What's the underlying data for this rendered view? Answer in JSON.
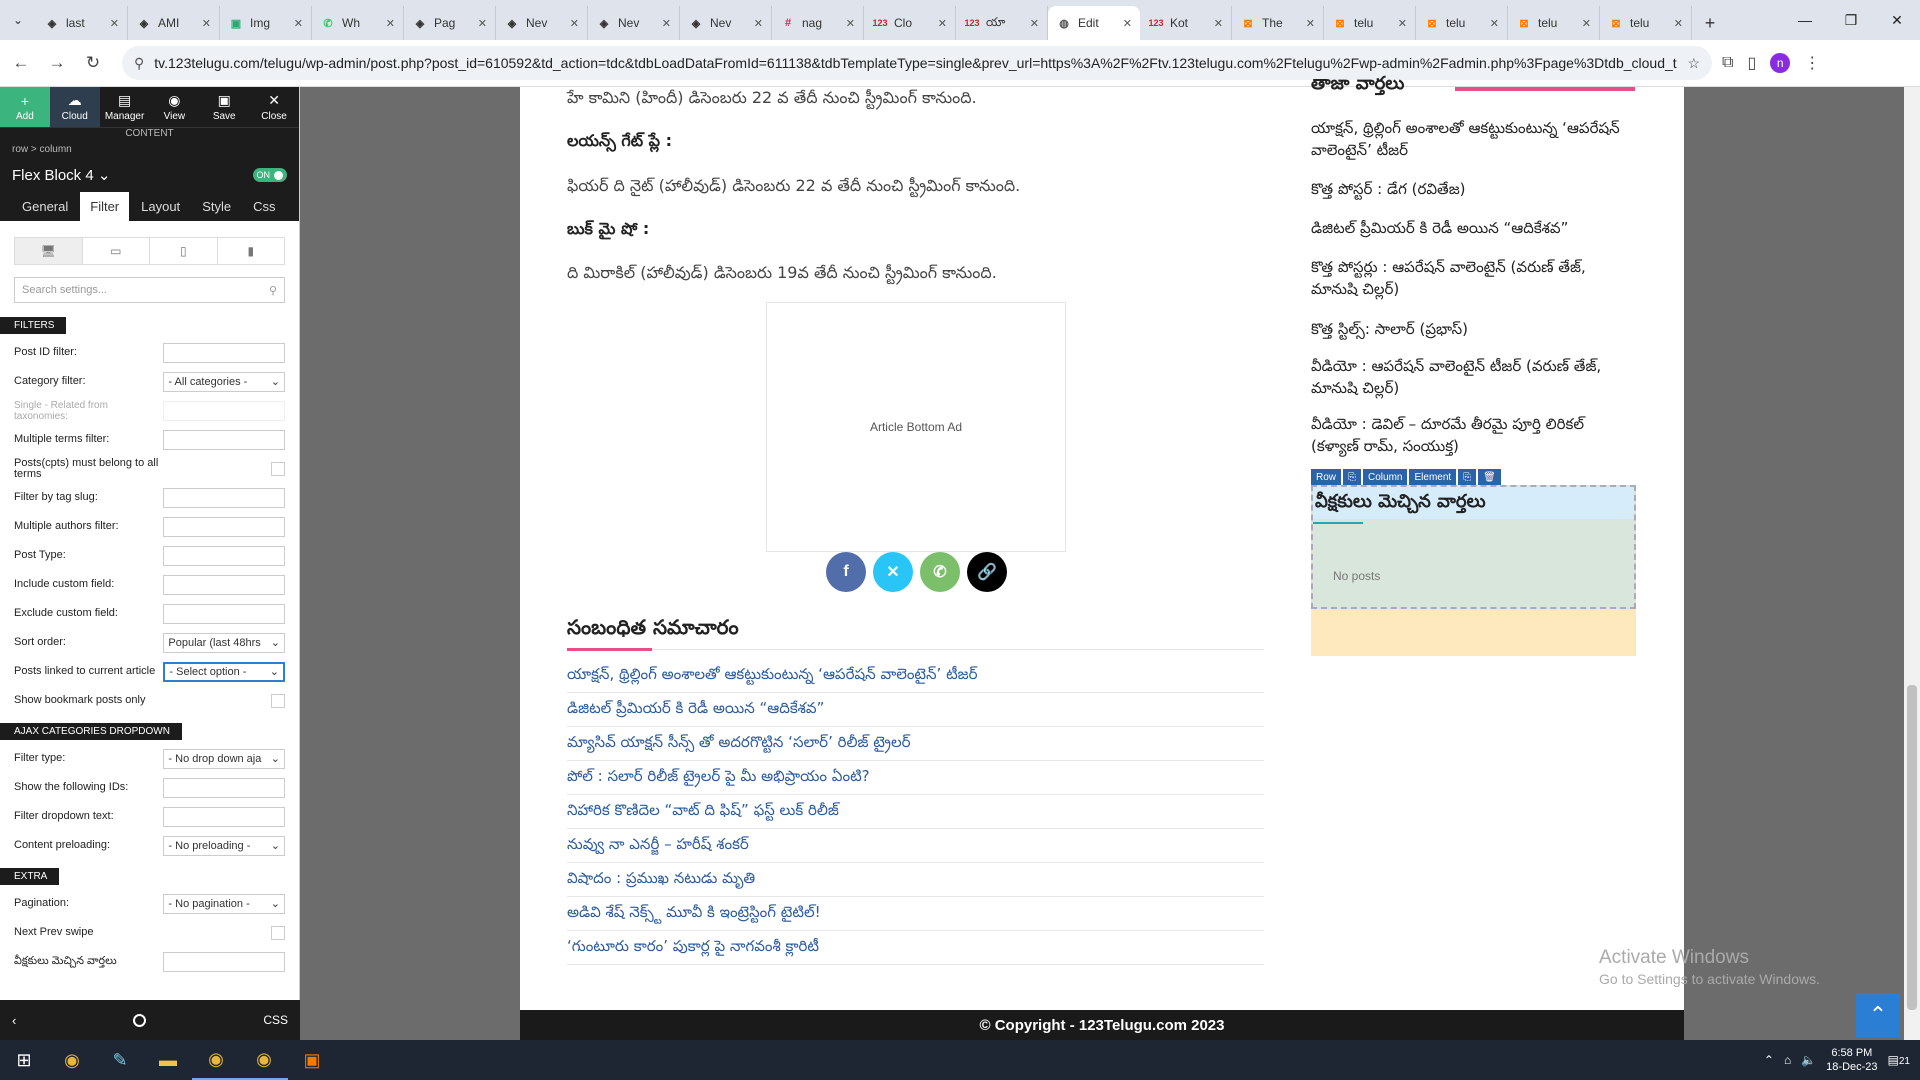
{
  "browser": {
    "tabs": [
      {
        "icon": "webpage-icon",
        "label": "last",
        "color": "#333"
      },
      {
        "icon": "webpage-icon",
        "label": "AMI",
        "color": "#333"
      },
      {
        "icon": "img-icon",
        "label": "Img",
        "color": "#2aa870"
      },
      {
        "icon": "whatsapp-icon",
        "label": "Wh",
        "color": "#25d366"
      },
      {
        "icon": "webpage-icon",
        "label": "Pag",
        "color": "#333"
      },
      {
        "icon": "webpage-icon",
        "label": "Nev",
        "color": "#333"
      },
      {
        "icon": "webpage-icon",
        "label": "Nev",
        "color": "#333"
      },
      {
        "icon": "webpage-icon",
        "label": "Nev",
        "color": "#333"
      },
      {
        "icon": "slack-icon",
        "label": "nag",
        "color": "#e01e5a"
      },
      {
        "icon": "site-123-icon",
        "label": "Clo",
        "color": "#c62828"
      },
      {
        "icon": "site-123-icon",
        "label": "యా",
        "color": "#c62828"
      },
      {
        "icon": "globe-icon",
        "label": "Edit",
        "color": "#555",
        "active": true
      },
      {
        "icon": "site-123-icon",
        "label": "Kot",
        "color": "#c62828"
      },
      {
        "icon": "blogger-icon",
        "label": "The",
        "color": "#f57c00"
      },
      {
        "icon": "blogger-icon",
        "label": "telu",
        "color": "#f57c00"
      },
      {
        "icon": "blogger-icon",
        "label": "telu",
        "color": "#f57c00"
      },
      {
        "icon": "blogger-icon",
        "label": "telu",
        "color": "#f57c00"
      },
      {
        "icon": "blogger-icon",
        "label": "telu",
        "color": "#f57c00"
      }
    ],
    "url": "tv.123telugu.com/telugu/wp-admin/post.php?post_id=610592&td_action=tdc&tdbLoadDataFromId=611138&tdbTemplateType=single&prev_url=https%3A%2F%2Ftv.123telugu.com%2Ftelugu%2Fwp-admin%2Fadmin.php%3Fpage%3Dtdb_cloud_te...",
    "profile_initial": "n"
  },
  "editor": {
    "top_buttons": {
      "add": "Add",
      "cloud": "Cloud",
      "manager": "Manager",
      "view": "View",
      "save": "Save",
      "close": "Close"
    },
    "content_label": "CONTENT",
    "breadcrumb": "row  >  column",
    "block_name": "Flex Block 4",
    "toggle_label": "ON",
    "tabs": [
      "General",
      "Filter",
      "Layout",
      "Style",
      "Css"
    ],
    "search_placeholder": "Search settings...",
    "filters_title": "FILTERS",
    "filters": [
      {
        "label": "Post ID filter:",
        "type": "input",
        "value": ""
      },
      {
        "label": "Category filter:",
        "type": "select",
        "value": "- All categories -"
      },
      {
        "label": "Single - Related from taxonomies:",
        "type": "input-dim",
        "value": ""
      },
      {
        "label": "Multiple terms filter:",
        "type": "input",
        "value": ""
      },
      {
        "label": "Posts(cpts) must belong to all terms",
        "type": "check",
        "value": ""
      },
      {
        "label": "Filter by tag slug:",
        "type": "input",
        "value": ""
      },
      {
        "label": "Multiple authors filter:",
        "type": "input",
        "value": ""
      },
      {
        "label": "Post Type:",
        "type": "input",
        "value": ""
      },
      {
        "label": "Include custom field:",
        "type": "input",
        "value": ""
      },
      {
        "label": "Exclude custom field:",
        "type": "input",
        "value": ""
      },
      {
        "label": "Sort order:",
        "type": "select",
        "value": "Popular (last 48hrs"
      },
      {
        "label": "Posts linked to current article",
        "type": "select-active",
        "value": "- Select option -"
      },
      {
        "label": "Show bookmark posts only",
        "type": "check",
        "value": ""
      }
    ],
    "ajax_title": "AJAX CATEGORIES DROPDOWN",
    "ajax": [
      {
        "label": "Filter type:",
        "type": "select",
        "value": "- No drop down aja"
      },
      {
        "label": "Show the following IDs:",
        "type": "input",
        "value": ""
      },
      {
        "label": "Filter dropdown text:",
        "type": "input",
        "value": ""
      },
      {
        "label": "Content preloading:",
        "type": "select",
        "value": "- No preloading -"
      }
    ],
    "extra_title": "EXTRA",
    "extra": [
      {
        "label": "Pagination:",
        "type": "select",
        "value": "- No pagination -"
      },
      {
        "label": "Next Prev swipe",
        "type": "check",
        "value": ""
      },
      {
        "label": "వీక్షకులు మెచ్చిన వార్తలు",
        "type": "input",
        "value": ""
      }
    ],
    "bottom_css": "CSS"
  },
  "article": {
    "line1": "హే కామిని (హిందీ) డిసెంబరు 22 వ తేదీ నుంచి స్ట్రీమింగ్ కానుంది.",
    "heading1": "లయన్స్ గేట్ ప్లే :",
    "line2": "ఫియర్ ది నైట్ (హాలీవుడ్) డిసెంబరు 22 వ తేదీ నుంచి స్ట్రీమింగ్ కానుంది.",
    "heading2": "బుక్ మై షో :",
    "line3": "ది మిరాకిల్ (హాలీవుడ్) డిసెంబరు 19వ తేదీ నుంచి స్ట్రీమింగ్ కానుంది.",
    "ad_label": "Article Bottom Ad",
    "share": [
      {
        "icon": "facebook-icon",
        "glyph": "f",
        "color": "#516eab"
      },
      {
        "icon": "x-twitter-icon",
        "glyph": "✕",
        "color": "#29c5f6"
      },
      {
        "icon": "whatsapp-icon",
        "glyph": "✆",
        "color": "#7bbf6a"
      },
      {
        "icon": "link-icon",
        "glyph": "🔗",
        "color": "#000000"
      }
    ],
    "related_title": "సంబంధిత సమాచారం",
    "related": [
      "యాక్షన్, థ్రిల్లింగ్ అంశాలతో ఆకట్టుకుంటున్న ‘ఆపరేషన్ వాలెంటైన్’ టీజర్",
      "డిజిటల్ ప్రీమియర్ కి రెడీ అయిన “ఆదికేశవ”",
      "మ్యాసివ్ యాక్షన్ సీన్స్ తో అదరగొట్టిన ‘సలార్’ రిలీజ్ ట్రైలర్",
      "పోల్ : సలార్ రిలీజ్ ట్రైలర్ పై మీ అభిప్రాయం ఏంటి?",
      "నిహారిక కొణిదెల “వాట్ ది ఫిష్” ఫస్ట్ లుక్ రిలీజ్",
      "నువ్వు నా ఎనర్జీ – హరీష్ శంకర్",
      "విషాదం : ప్రముఖ నటుడు మృతి",
      "అడివి శేష్ నెక్స్ట్ మూవీ కి ఇంట్రెస్టింగ్ టైటిల్!",
      "‘గుంటూరు కారం’ పుకార్ల పై నాగవంశీ క్లారిటీ"
    ]
  },
  "sidebar": {
    "heading": "తాజా వార్తలు",
    "items": [
      "యాక్షన్, థ్రిల్లింగ్ అంశాలతో ఆకట్టుకుంటున్న ‘ఆపరేషన్ వాలెంటైన్’ టీజర్",
      "కొత్త పోస్టర్ : డేగ (రవితేజ)",
      "డిజిటల్ ప్రీమియర్ కి రెడీ అయిన “ఆదికేశవ”",
      "కొత్త పోస్టర్లు : ఆపరేషన్ వాలెంటైన్ (వరుణ్ తేజ్, మానుషి చిల్లర్)",
      "కొత్త స్టిల్స్: సాలార్ (ప్రభాస్)",
      "వీడియో : ఆపరేషన్ వాలెంటైన్ టీజర్ (వరుణ్ తేజ్, మానుషి చిల్లర్)",
      "వీడియో : డెవిల్ – దూరమే తీరమై పూర్తి లిరికల్ (కళ్యాణ్ రామ్, సంయుక్త)"
    ],
    "crumbs": [
      "Row",
      "⎘",
      "Column",
      "Element",
      "⎘",
      "🗑"
    ],
    "widget_title": "వీక్షకులు మెచ్చిన వార్తలు",
    "no_posts": "No posts"
  },
  "footer": "© Copyright - 123Telugu.com 2023",
  "watermark": {
    "title": "Activate Windows",
    "sub": "Go to Settings to activate Windows."
  },
  "taskbar": {
    "time": "6:58 PM",
    "date": "18-Dec-23",
    "notif": "21"
  }
}
